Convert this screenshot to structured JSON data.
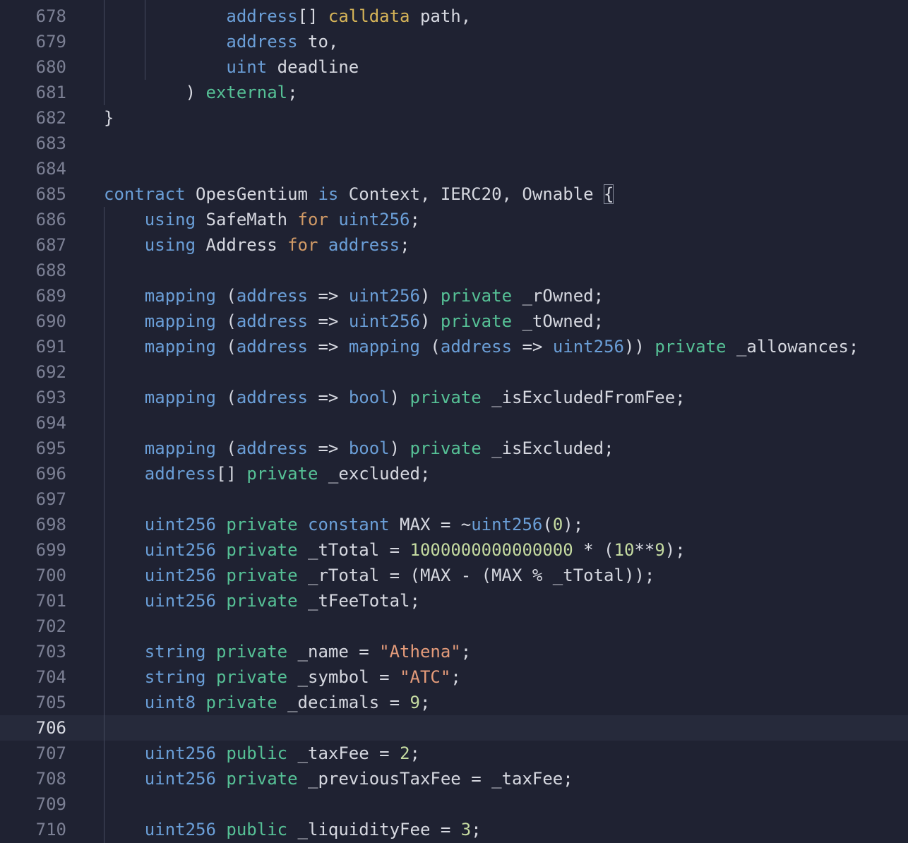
{
  "editor": {
    "language": "solidity",
    "current_line": 706,
    "colors": {
      "background": "#1f2232",
      "line_number": "#7c8094",
      "keyword": "#6b9fd8",
      "visibility": "#56c196",
      "control": "#d19a66",
      "string": "#e49b7a",
      "number": "#c5dba1",
      "identifier": "#d6d8e0"
    },
    "lines": [
      {
        "n": "678",
        "tokens": [
          [
            "            ",
            "id"
          ],
          [
            "address",
            "kw"
          ],
          [
            "[] ",
            "punc"
          ],
          [
            "calldata",
            "yellow"
          ],
          [
            " path,",
            "id"
          ]
        ]
      },
      {
        "n": "679",
        "tokens": [
          [
            "            ",
            "id"
          ],
          [
            "address",
            "kw"
          ],
          [
            " to,",
            "id"
          ]
        ]
      },
      {
        "n": "680",
        "tokens": [
          [
            "            ",
            "id"
          ],
          [
            "uint",
            "kw"
          ],
          [
            " deadline",
            "id"
          ]
        ]
      },
      {
        "n": "681",
        "tokens": [
          [
            "        ) ",
            "punc"
          ],
          [
            "external",
            "vis"
          ],
          [
            ";",
            "punc"
          ]
        ]
      },
      {
        "n": "682",
        "tokens": [
          [
            "}",
            "punc"
          ]
        ]
      },
      {
        "n": "683",
        "tokens": []
      },
      {
        "n": "684",
        "tokens": []
      },
      {
        "n": "685",
        "tokens": [
          [
            "contract",
            "kw"
          ],
          [
            " OpesGentium ",
            "id"
          ],
          [
            "is",
            "kw"
          ],
          [
            " Context, IERC20, Ownable ",
            "id"
          ],
          [
            "{",
            "bracket"
          ]
        ]
      },
      {
        "n": "686",
        "tokens": [
          [
            "    ",
            "id"
          ],
          [
            "using",
            "kw"
          ],
          [
            " SafeMath ",
            "id"
          ],
          [
            "for",
            "orange"
          ],
          [
            " ",
            "id"
          ],
          [
            "uint256",
            "kw"
          ],
          [
            ";",
            "punc"
          ]
        ]
      },
      {
        "n": "687",
        "tokens": [
          [
            "    ",
            "id"
          ],
          [
            "using",
            "kw"
          ],
          [
            " Address ",
            "id"
          ],
          [
            "for",
            "orange"
          ],
          [
            " ",
            "id"
          ],
          [
            "address",
            "kw"
          ],
          [
            ";",
            "punc"
          ]
        ]
      },
      {
        "n": "688",
        "tokens": []
      },
      {
        "n": "689",
        "tokens": [
          [
            "    ",
            "id"
          ],
          [
            "mapping",
            "kw"
          ],
          [
            " (",
            "punc"
          ],
          [
            "address",
            "kw"
          ],
          [
            " => ",
            "punc"
          ],
          [
            "uint256",
            "kw"
          ],
          [
            ") ",
            "punc"
          ],
          [
            "private",
            "vis"
          ],
          [
            " _rOwned;",
            "id"
          ]
        ]
      },
      {
        "n": "690",
        "tokens": [
          [
            "    ",
            "id"
          ],
          [
            "mapping",
            "kw"
          ],
          [
            " (",
            "punc"
          ],
          [
            "address",
            "kw"
          ],
          [
            " => ",
            "punc"
          ],
          [
            "uint256",
            "kw"
          ],
          [
            ") ",
            "punc"
          ],
          [
            "private",
            "vis"
          ],
          [
            " _tOwned;",
            "id"
          ]
        ]
      },
      {
        "n": "691",
        "tokens": [
          [
            "    ",
            "id"
          ],
          [
            "mapping",
            "kw"
          ],
          [
            " (",
            "punc"
          ],
          [
            "address",
            "kw"
          ],
          [
            " => ",
            "punc"
          ],
          [
            "mapping",
            "kw"
          ],
          [
            " (",
            "punc"
          ],
          [
            "address",
            "kw"
          ],
          [
            " => ",
            "punc"
          ],
          [
            "uint256",
            "kw"
          ],
          [
            ")) ",
            "punc"
          ],
          [
            "private",
            "vis"
          ],
          [
            " _allowances;",
            "id"
          ]
        ]
      },
      {
        "n": "692",
        "tokens": []
      },
      {
        "n": "693",
        "tokens": [
          [
            "    ",
            "id"
          ],
          [
            "mapping",
            "kw"
          ],
          [
            " (",
            "punc"
          ],
          [
            "address",
            "kw"
          ],
          [
            " => ",
            "punc"
          ],
          [
            "bool",
            "kw"
          ],
          [
            ") ",
            "punc"
          ],
          [
            "private",
            "vis"
          ],
          [
            " _isExcludedFromFee;",
            "id"
          ]
        ]
      },
      {
        "n": "694",
        "tokens": []
      },
      {
        "n": "695",
        "tokens": [
          [
            "    ",
            "id"
          ],
          [
            "mapping",
            "kw"
          ],
          [
            " (",
            "punc"
          ],
          [
            "address",
            "kw"
          ],
          [
            " => ",
            "punc"
          ],
          [
            "bool",
            "kw"
          ],
          [
            ") ",
            "punc"
          ],
          [
            "private",
            "vis"
          ],
          [
            " _isExcluded;",
            "id"
          ]
        ]
      },
      {
        "n": "696",
        "tokens": [
          [
            "    ",
            "id"
          ],
          [
            "address",
            "kw"
          ],
          [
            "[] ",
            "punc"
          ],
          [
            "private",
            "vis"
          ],
          [
            " _excluded;",
            "id"
          ]
        ]
      },
      {
        "n": "697",
        "tokens": []
      },
      {
        "n": "698",
        "tokens": [
          [
            "    ",
            "id"
          ],
          [
            "uint256",
            "kw"
          ],
          [
            " ",
            "id"
          ],
          [
            "private",
            "vis"
          ],
          [
            " ",
            "id"
          ],
          [
            "constant",
            "kw"
          ],
          [
            " MAX = ~",
            "id"
          ],
          [
            "uint256",
            "kw"
          ],
          [
            "(",
            "punc"
          ],
          [
            "0",
            "num"
          ],
          [
            ");",
            "punc"
          ]
        ]
      },
      {
        "n": "699",
        "tokens": [
          [
            "    ",
            "id"
          ],
          [
            "uint256",
            "kw"
          ],
          [
            " ",
            "id"
          ],
          [
            "private",
            "vis"
          ],
          [
            " _tTotal = ",
            "id"
          ],
          [
            "1000000000000000",
            "num"
          ],
          [
            " * (",
            "punc"
          ],
          [
            "10",
            "num"
          ],
          [
            "**",
            "punc"
          ],
          [
            "9",
            "num"
          ],
          [
            ");",
            "punc"
          ]
        ]
      },
      {
        "n": "700",
        "tokens": [
          [
            "    ",
            "id"
          ],
          [
            "uint256",
            "kw"
          ],
          [
            " ",
            "id"
          ],
          [
            "private",
            "vis"
          ],
          [
            " _rTotal = (MAX - (MAX % _tTotal));",
            "id"
          ]
        ]
      },
      {
        "n": "701",
        "tokens": [
          [
            "    ",
            "id"
          ],
          [
            "uint256",
            "kw"
          ],
          [
            " ",
            "id"
          ],
          [
            "private",
            "vis"
          ],
          [
            " _tFeeTotal;",
            "id"
          ]
        ]
      },
      {
        "n": "702",
        "tokens": []
      },
      {
        "n": "703",
        "tokens": [
          [
            "    ",
            "id"
          ],
          [
            "string",
            "kw"
          ],
          [
            " ",
            "id"
          ],
          [
            "private",
            "vis"
          ],
          [
            " _name = ",
            "id"
          ],
          [
            "\"Athena\"",
            "str"
          ],
          [
            ";",
            "punc"
          ]
        ]
      },
      {
        "n": "704",
        "tokens": [
          [
            "    ",
            "id"
          ],
          [
            "string",
            "kw"
          ],
          [
            " ",
            "id"
          ],
          [
            "private",
            "vis"
          ],
          [
            " _symbol = ",
            "id"
          ],
          [
            "\"ATC\"",
            "str"
          ],
          [
            ";",
            "punc"
          ]
        ]
      },
      {
        "n": "705",
        "tokens": [
          [
            "    ",
            "id"
          ],
          [
            "uint8",
            "kw"
          ],
          [
            " ",
            "id"
          ],
          [
            "private",
            "vis"
          ],
          [
            " _decimals = ",
            "id"
          ],
          [
            "9",
            "num"
          ],
          [
            ";",
            "punc"
          ]
        ]
      },
      {
        "n": "706",
        "tokens": []
      },
      {
        "n": "707",
        "tokens": [
          [
            "    ",
            "id"
          ],
          [
            "uint256",
            "kw"
          ],
          [
            " ",
            "id"
          ],
          [
            "public",
            "vis"
          ],
          [
            " _taxFee = ",
            "id"
          ],
          [
            "2",
            "num"
          ],
          [
            ";",
            "punc"
          ]
        ]
      },
      {
        "n": "708",
        "tokens": [
          [
            "    ",
            "id"
          ],
          [
            "uint256",
            "kw"
          ],
          [
            " ",
            "id"
          ],
          [
            "private",
            "vis"
          ],
          [
            " _previousTaxFee = _taxFee;",
            "id"
          ]
        ]
      },
      {
        "n": "709",
        "tokens": []
      },
      {
        "n": "710",
        "tokens": [
          [
            "    ",
            "id"
          ],
          [
            "uint256",
            "kw"
          ],
          [
            " ",
            "id"
          ],
          [
            "public",
            "vis"
          ],
          [
            " _liquidityFee = ",
            "id"
          ],
          [
            "3",
            "num"
          ],
          [
            ";",
            "punc"
          ]
        ]
      }
    ]
  }
}
